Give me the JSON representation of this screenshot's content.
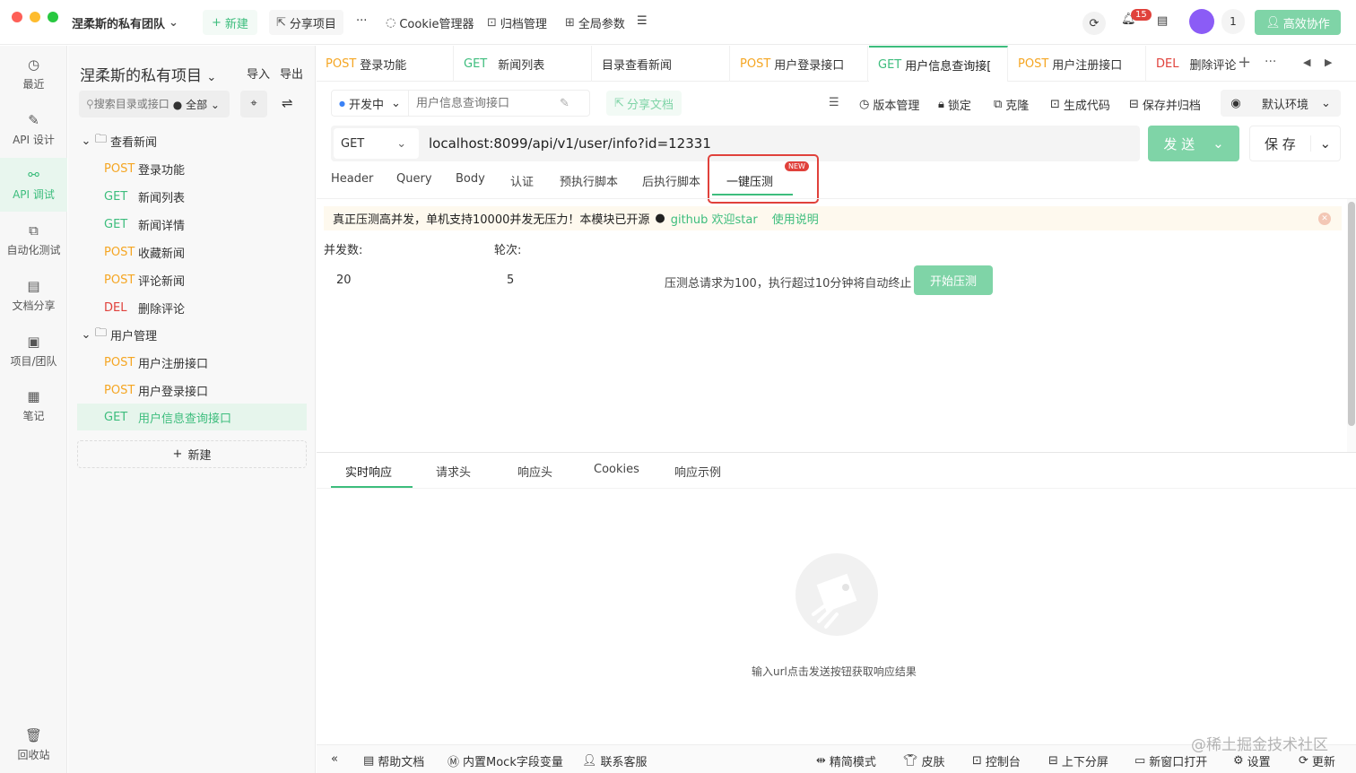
{
  "titlebar": {
    "team_name": "涅柔斯的私有团队",
    "new_label": "新建",
    "share_label": "分享项目",
    "more": "···",
    "cookie_label": "Cookie管理器",
    "archive_label": "归档管理",
    "global_params_label": "全局参数",
    "notif_count": "15",
    "user_count": "1",
    "collab_label": "高效协作"
  },
  "leftnav": {
    "items": [
      {
        "label": "最近",
        "icon": "clock-icon"
      },
      {
        "label": "API 设计",
        "icon": "edit-icon"
      },
      {
        "label": "API 调试",
        "icon": "link-icon"
      },
      {
        "label": "自动化测试",
        "icon": "flow-icon"
      },
      {
        "label": "文档分享",
        "icon": "doc-icon"
      },
      {
        "label": "项目/团队",
        "icon": "project-icon"
      },
      {
        "label": "笔记",
        "icon": "note-icon"
      }
    ],
    "trash_label": "回收站"
  },
  "tree": {
    "project_title": "涅柔斯的私有项目",
    "import_label": "导入",
    "export_label": "导出",
    "search_placeholder": "搜索目录或接口",
    "filter_label": "全部",
    "folder1": "查看新闻",
    "folder2": "用户管理",
    "items": [
      {
        "method": "POST",
        "name": "登录功能"
      },
      {
        "method": "GET",
        "name": "新闻列表"
      },
      {
        "method": "GET",
        "name": "新闻详情"
      },
      {
        "method": "POST",
        "name": "收藏新闻"
      },
      {
        "method": "POST",
        "name": "评论新闻"
      },
      {
        "method": "DEL",
        "name": "删除评论"
      },
      {
        "method": "POST",
        "name": "用户注册接口"
      },
      {
        "method": "POST",
        "name": "用户登录接口"
      },
      {
        "method": "GET",
        "name": "用户信息查询接口"
      }
    ],
    "new_label": "新建"
  },
  "tabs": [
    {
      "method": "POST",
      "name": "登录功能"
    },
    {
      "method": "GET",
      "name": "新闻列表"
    },
    {
      "method": "",
      "name": "目录查看新闻"
    },
    {
      "method": "POST",
      "name": "用户登录接口"
    },
    {
      "method": "GET",
      "name": "用户信息查询接["
    },
    {
      "method": "POST",
      "name": "用户注册接口"
    },
    {
      "method": "DEL",
      "name": "删除评论"
    }
  ],
  "toolbar": {
    "status": "开发中",
    "api_name_placeholder": "用户信息查询接口",
    "share_doc": "分享文档",
    "version": "版本管理",
    "lock": "锁定",
    "clone": "克隆",
    "gen_code": "生成代码",
    "save_archive": "保存并归档",
    "env": "默认环境"
  },
  "request": {
    "method": "GET",
    "url": "localhost:8099/api/v1/user/info?id=12331",
    "send": "发 送",
    "save": "保 存"
  },
  "req_tabs": [
    "Header",
    "Query",
    "Body",
    "认证",
    "预执行脚本",
    "后执行脚本",
    "一键压测"
  ],
  "new_badge": "NEW",
  "banner": {
    "text": "真正压测高并发，单机支持10000并发无压力！本模块已开源",
    "github": "github 欢迎star",
    "usage": "使用说明"
  },
  "stress": {
    "concurrency_label": "并发数:",
    "rounds_label": "轮次:",
    "concurrency": "20",
    "rounds": "5",
    "hint": "压测总请求为100，执行超过10分钟将自动终止",
    "start": "开始压测"
  },
  "resp_tabs": [
    "实时响应",
    "请求头",
    "响应头",
    "Cookies",
    "响应示例"
  ],
  "empty_hint": "输入url点击发送按钮获取响应结果",
  "footer": {
    "help": "帮助文档",
    "mock": "内置Mock字段变量",
    "support": "联系客服",
    "simple": "精简模式",
    "skin": "皮肤",
    "console": "控制台",
    "split": "上下分屏",
    "new_window": "新窗口打开",
    "settings": "设置",
    "update": "更新"
  },
  "watermark": "@稀土掘金技术社区",
  "colors": {
    "accent": "#3dbd7d",
    "post": "#f5a623",
    "get": "#3dbd7d",
    "del": "#e0413b",
    "highlight": "#e0413b"
  }
}
